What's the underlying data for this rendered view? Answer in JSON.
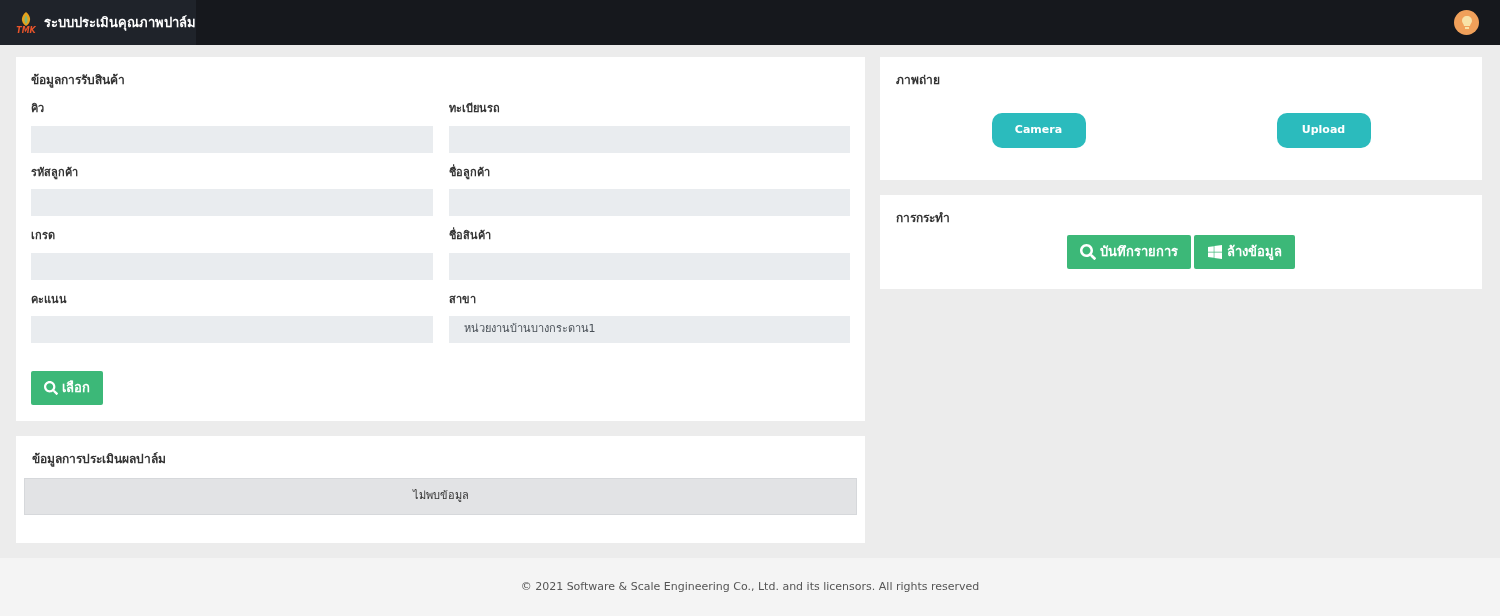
{
  "header": {
    "logo_text": "TMK",
    "title": "ระบบประเมินคุณภาพปาล์ม"
  },
  "receiving": {
    "title": "ข้อมูลการรับสินค้า",
    "fields": [
      {
        "label": "คิว"
      },
      {
        "label": "ทะเบียนรถ"
      },
      {
        "label": "รหัสลูกค้า"
      },
      {
        "label": "ชื่อลูกค้า"
      },
      {
        "label": "เกรด"
      },
      {
        "label": "ชื่อสินค้า"
      },
      {
        "label": "คะแนน"
      },
      {
        "label": "สาขา",
        "value": "หน่วยงานบ้านบางกระดาน1"
      }
    ],
    "select_button": "เลือก"
  },
  "evaluation": {
    "title": "ข้อมูลการประเมินผลปาล์ม",
    "empty_message": "ไม่พบข้อมูล"
  },
  "photo": {
    "title": "ภาพถ่าย",
    "buttons": [
      "Camera",
      "Upload"
    ]
  },
  "actions": {
    "title": "การกระทำ",
    "buttons": [
      {
        "kind": "search",
        "label": "บันทึกรายการ"
      },
      {
        "kind": "windows",
        "label": "ล้างข้อมูล"
      }
    ]
  },
  "footer": "© 2021 Software & Scale Engineering Co., Ltd. and its licensors. All rights reserved"
}
